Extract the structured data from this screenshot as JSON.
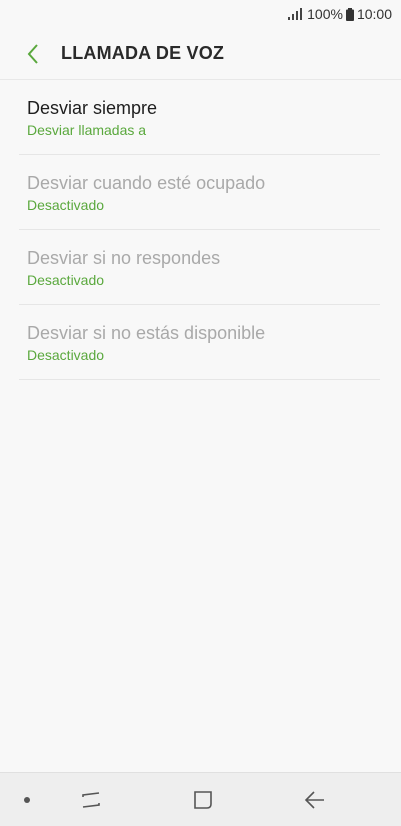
{
  "status_bar": {
    "battery_percent": "100%",
    "time": "10:00",
    "icons": [
      "signal-icon",
      "battery-icon"
    ]
  },
  "header": {
    "title": "LLAMADA DE VOZ",
    "back_icon": "chevron-left-icon",
    "accent_color": "#5aa83d"
  },
  "items": [
    {
      "title": "Desviar siempre",
      "subtitle": "Desviar llamadas a",
      "enabled": true
    },
    {
      "title": "Desviar cuando esté ocupado",
      "subtitle": "Desactivado",
      "enabled": false
    },
    {
      "title": "Desviar si no respondes",
      "subtitle": "Desactivado",
      "enabled": false
    },
    {
      "title": "Desviar si no estás disponible",
      "subtitle": "Desactivado",
      "enabled": false
    }
  ],
  "nav_bar": {
    "buttons": [
      "recents-icon",
      "home-icon",
      "back-arrow-icon"
    ]
  }
}
